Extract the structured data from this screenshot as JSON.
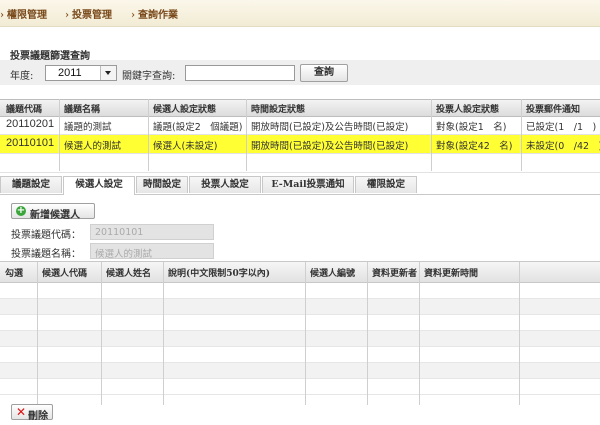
{
  "breadcrumb": [
    "權限管理",
    "投票管理",
    "查詢作業"
  ],
  "query": {
    "title": "投票議題篩選查詢",
    "year_label": "年度:",
    "year_value": "2011",
    "keyword_label": "關鍵字查詢:",
    "keyword_value": "",
    "search_button": "查詢"
  },
  "topics": {
    "columns": [
      "議題代碼",
      "議題名稱",
      "候選人設定狀態",
      "時間設定狀態",
      "投票人設定狀態",
      "投票郵件通知"
    ],
    "rows": [
      [
        "20110201",
        "議題的測試",
        "議題(設定2　個議題)",
        "開放時間(已設定)及公告時間(已設定)",
        "對象(設定1　名)",
        "已設定(1　/1　)"
      ],
      [
        "20110101",
        "候選人的測試",
        "候選人(未設定)",
        "開放時間(已設定)及公告時間(已設定)",
        "對象(設定42　名)",
        "未設定(0　/42　)"
      ]
    ]
  },
  "tabs": [
    "議題設定",
    "候選人設定",
    "時間設定",
    "投票人設定",
    "E-Mail投票通知",
    "權限設定"
  ],
  "candidate": {
    "add_button": "新增候選人",
    "code_label": "投票議題代碼：",
    "code_value": "20110101",
    "name_label": "投票議題名稱：",
    "name_value": "候選人的測試",
    "columns": [
      "勾選",
      "候選人代碼",
      "候選人姓名",
      "說明(中文限制50字以內)",
      "候選人編號",
      "資料更新者",
      "資料更新時間"
    ],
    "delete_button": "刪除"
  },
  "colors": {
    "selected_row": "#ffff33",
    "breadcrumb_text": "#7a4a1c",
    "add_icon": "#3aa53a",
    "delete_icon": "#dd1111"
  },
  "icons": {
    "add": "plus-circle-icon",
    "delete": "x-icon",
    "breadcrumb": "arrow-right-icon",
    "dropdown": "chevron-down-icon"
  }
}
